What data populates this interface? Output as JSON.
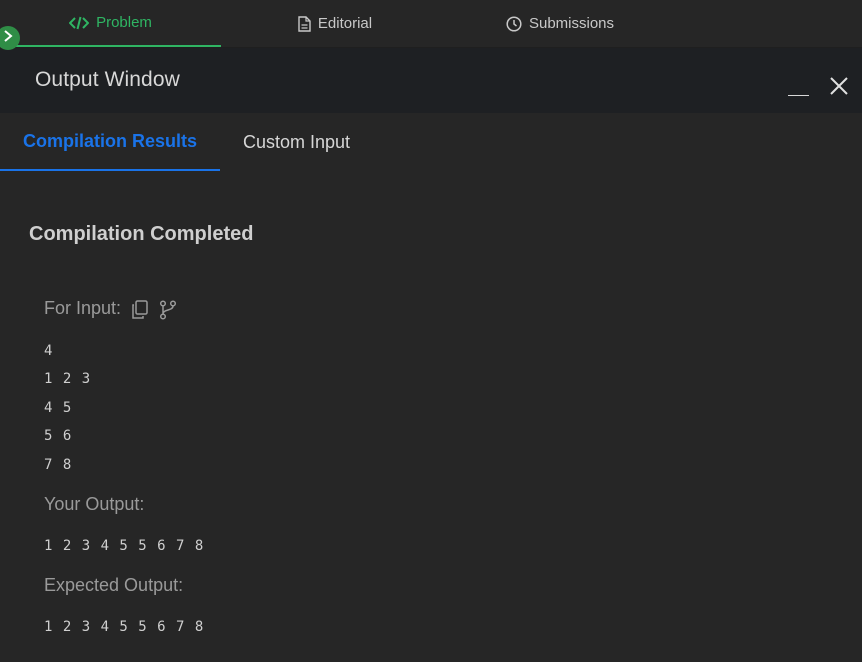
{
  "top_tabs": [
    {
      "label": "Problem",
      "icon": "code-icon",
      "active": true
    },
    {
      "label": "Editorial",
      "icon": "document-icon",
      "active": false
    },
    {
      "label": "Submissions",
      "icon": "clock-icon",
      "active": false
    }
  ],
  "output_window": {
    "title": "Output Window",
    "tabs": [
      {
        "label": "Compilation Results",
        "active": true
      },
      {
        "label": "Custom Input",
        "active": false
      }
    ],
    "status": "Compilation Completed",
    "input_label": "For Input:",
    "input_lines": [
      "4",
      "1 2 3",
      "4 5",
      "5 6",
      "7 8"
    ],
    "output_label": "Your Output:",
    "output_value": "1 2 3 4 5 5 6 7 8",
    "expected_label": "Expected Output:",
    "expected_value": "1 2 3 4 5 5 6 7 8"
  },
  "colors": {
    "background": "#262626",
    "header": "#1e2023",
    "accent_green": "#2fb563",
    "accent_blue": "#1a73e8"
  }
}
